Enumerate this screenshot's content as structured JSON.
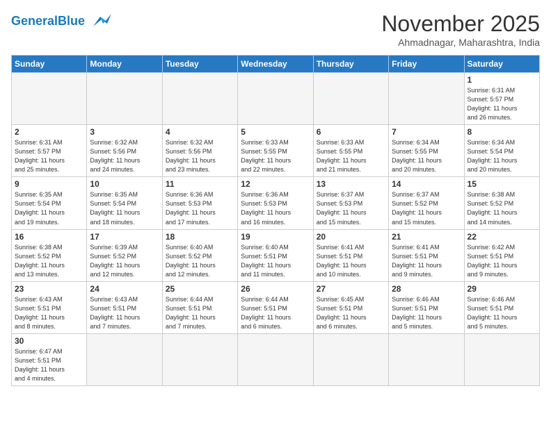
{
  "header": {
    "logo_general": "General",
    "logo_blue": "Blue",
    "month": "November 2025",
    "location": "Ahmadnagar, Maharashtra, India"
  },
  "days_of_week": [
    "Sunday",
    "Monday",
    "Tuesday",
    "Wednesday",
    "Thursday",
    "Friday",
    "Saturday"
  ],
  "weeks": [
    [
      {
        "day": "",
        "info": ""
      },
      {
        "day": "",
        "info": ""
      },
      {
        "day": "",
        "info": ""
      },
      {
        "day": "",
        "info": ""
      },
      {
        "day": "",
        "info": ""
      },
      {
        "day": "",
        "info": ""
      },
      {
        "day": "1",
        "info": "Sunrise: 6:31 AM\nSunset: 5:57 PM\nDaylight: 11 hours\nand 26 minutes."
      }
    ],
    [
      {
        "day": "2",
        "info": "Sunrise: 6:31 AM\nSunset: 5:57 PM\nDaylight: 11 hours\nand 25 minutes."
      },
      {
        "day": "3",
        "info": "Sunrise: 6:32 AM\nSunset: 5:56 PM\nDaylight: 11 hours\nand 24 minutes."
      },
      {
        "day": "4",
        "info": "Sunrise: 6:32 AM\nSunset: 5:56 PM\nDaylight: 11 hours\nand 23 minutes."
      },
      {
        "day": "5",
        "info": "Sunrise: 6:33 AM\nSunset: 5:55 PM\nDaylight: 11 hours\nand 22 minutes."
      },
      {
        "day": "6",
        "info": "Sunrise: 6:33 AM\nSunset: 5:55 PM\nDaylight: 11 hours\nand 21 minutes."
      },
      {
        "day": "7",
        "info": "Sunrise: 6:34 AM\nSunset: 5:55 PM\nDaylight: 11 hours\nand 20 minutes."
      },
      {
        "day": "8",
        "info": "Sunrise: 6:34 AM\nSunset: 5:54 PM\nDaylight: 11 hours\nand 20 minutes."
      }
    ],
    [
      {
        "day": "9",
        "info": "Sunrise: 6:35 AM\nSunset: 5:54 PM\nDaylight: 11 hours\nand 19 minutes."
      },
      {
        "day": "10",
        "info": "Sunrise: 6:35 AM\nSunset: 5:54 PM\nDaylight: 11 hours\nand 18 minutes."
      },
      {
        "day": "11",
        "info": "Sunrise: 6:36 AM\nSunset: 5:53 PM\nDaylight: 11 hours\nand 17 minutes."
      },
      {
        "day": "12",
        "info": "Sunrise: 6:36 AM\nSunset: 5:53 PM\nDaylight: 11 hours\nand 16 minutes."
      },
      {
        "day": "13",
        "info": "Sunrise: 6:37 AM\nSunset: 5:53 PM\nDaylight: 11 hours\nand 15 minutes."
      },
      {
        "day": "14",
        "info": "Sunrise: 6:37 AM\nSunset: 5:52 PM\nDaylight: 11 hours\nand 15 minutes."
      },
      {
        "day": "15",
        "info": "Sunrise: 6:38 AM\nSunset: 5:52 PM\nDaylight: 11 hours\nand 14 minutes."
      }
    ],
    [
      {
        "day": "16",
        "info": "Sunrise: 6:38 AM\nSunset: 5:52 PM\nDaylight: 11 hours\nand 13 minutes."
      },
      {
        "day": "17",
        "info": "Sunrise: 6:39 AM\nSunset: 5:52 PM\nDaylight: 11 hours\nand 12 minutes."
      },
      {
        "day": "18",
        "info": "Sunrise: 6:40 AM\nSunset: 5:52 PM\nDaylight: 11 hours\nand 12 minutes."
      },
      {
        "day": "19",
        "info": "Sunrise: 6:40 AM\nSunset: 5:51 PM\nDaylight: 11 hours\nand 11 minutes."
      },
      {
        "day": "20",
        "info": "Sunrise: 6:41 AM\nSunset: 5:51 PM\nDaylight: 11 hours\nand 10 minutes."
      },
      {
        "day": "21",
        "info": "Sunrise: 6:41 AM\nSunset: 5:51 PM\nDaylight: 11 hours\nand 9 minutes."
      },
      {
        "day": "22",
        "info": "Sunrise: 6:42 AM\nSunset: 5:51 PM\nDaylight: 11 hours\nand 9 minutes."
      }
    ],
    [
      {
        "day": "23",
        "info": "Sunrise: 6:43 AM\nSunset: 5:51 PM\nDaylight: 11 hours\nand 8 minutes."
      },
      {
        "day": "24",
        "info": "Sunrise: 6:43 AM\nSunset: 5:51 PM\nDaylight: 11 hours\nand 7 minutes."
      },
      {
        "day": "25",
        "info": "Sunrise: 6:44 AM\nSunset: 5:51 PM\nDaylight: 11 hours\nand 7 minutes."
      },
      {
        "day": "26",
        "info": "Sunrise: 6:44 AM\nSunset: 5:51 PM\nDaylight: 11 hours\nand 6 minutes."
      },
      {
        "day": "27",
        "info": "Sunrise: 6:45 AM\nSunset: 5:51 PM\nDaylight: 11 hours\nand 6 minutes."
      },
      {
        "day": "28",
        "info": "Sunrise: 6:46 AM\nSunset: 5:51 PM\nDaylight: 11 hours\nand 5 minutes."
      },
      {
        "day": "29",
        "info": "Sunrise: 6:46 AM\nSunset: 5:51 PM\nDaylight: 11 hours\nand 5 minutes."
      }
    ],
    [
      {
        "day": "30",
        "info": "Sunrise: 6:47 AM\nSunset: 5:51 PM\nDaylight: 11 hours\nand 4 minutes."
      },
      {
        "day": "",
        "info": ""
      },
      {
        "day": "",
        "info": ""
      },
      {
        "day": "",
        "info": ""
      },
      {
        "day": "",
        "info": ""
      },
      {
        "day": "",
        "info": ""
      },
      {
        "day": "",
        "info": ""
      }
    ]
  ]
}
